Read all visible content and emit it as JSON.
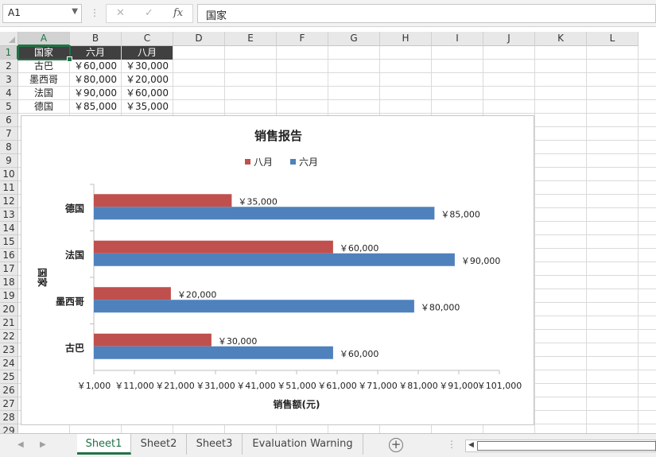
{
  "formula_bar": {
    "name_box": "A1",
    "cancel_icon": "✕",
    "confirm_icon": "✓",
    "fx_label": "fx",
    "formula_value": "国家"
  },
  "columns": [
    "A",
    "B",
    "C",
    "D",
    "E",
    "F",
    "G",
    "H",
    "I",
    "J",
    "K",
    "L"
  ],
  "rows": [
    "1",
    "2",
    "3",
    "4",
    "5",
    "6",
    "7",
    "8",
    "9",
    "10",
    "11",
    "12",
    "13",
    "14",
    "15",
    "16",
    "17",
    "18",
    "19",
    "20",
    "21",
    "22",
    "23",
    "24",
    "25",
    "26",
    "27",
    "28",
    "29"
  ],
  "table": {
    "headers": [
      "国家",
      "六月",
      "八月"
    ],
    "rows": [
      [
        "古巴",
        "￥60,000",
        "￥30,000"
      ],
      [
        "墨西哥",
        "￥80,000",
        "￥20,000"
      ],
      [
        "法国",
        "￥90,000",
        "￥60,000"
      ],
      [
        "德国",
        "￥85,000",
        "￥35,000"
      ]
    ]
  },
  "chart_data": {
    "type": "bar",
    "orientation": "horizontal",
    "title": "销售报告",
    "categories": [
      "古巴",
      "墨西哥",
      "法国",
      "德国"
    ],
    "series": [
      {
        "name": "六月",
        "values": [
          60000,
          80000,
          90000,
          85000
        ],
        "color": "#4f81bd",
        "labels": [
          "￥60,000",
          "￥80,000",
          "￥90,000",
          "￥85,000"
        ]
      },
      {
        "name": "八月",
        "values": [
          30000,
          20000,
          60000,
          35000
        ],
        "color": "#c0504d",
        "labels": [
          "￥30,000",
          "￥20,000",
          "￥60,000",
          "￥35,000"
        ]
      }
    ],
    "legend_order": [
      "八月",
      "六月"
    ],
    "legend_position": "top",
    "xlabel": "销售额(元)",
    "ylabel": "国家",
    "xlim": [
      1000,
      101000
    ],
    "x_ticks": [
      1000,
      11000,
      21000,
      31000,
      41000,
      51000,
      61000,
      71000,
      81000,
      91000,
      101000
    ],
    "x_tick_labels": [
      "￥1,000",
      "￥11,000",
      "￥21,000",
      "￥31,000",
      "￥41,000",
      "￥51,000",
      "￥61,000",
      "￥71,000",
      "￥81,000",
      "￥91,000",
      "￥101,000"
    ],
    "grid": false
  },
  "sheet_tabs": [
    "Sheet1",
    "Sheet2",
    "Sheet3",
    "Evaluation Warning"
  ],
  "active_sheet": "Sheet1"
}
